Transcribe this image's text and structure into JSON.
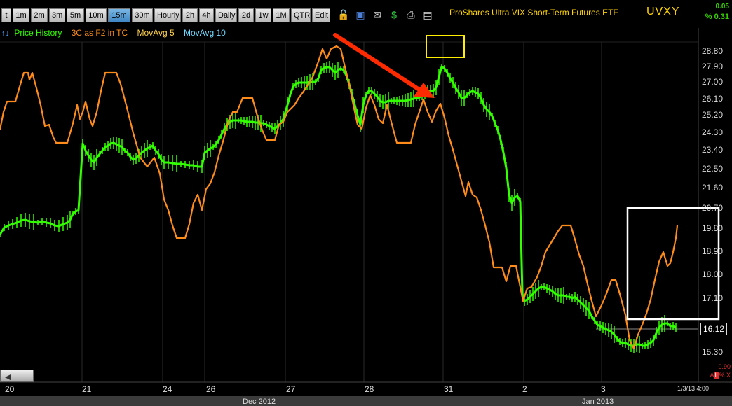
{
  "toolbar": {
    "timeframes": [
      {
        "label": "t"
      },
      {
        "label": "1m"
      },
      {
        "label": "2m"
      },
      {
        "label": "3m"
      },
      {
        "label": "5m"
      },
      {
        "label": "10m"
      },
      {
        "label": "15m",
        "active": true
      },
      {
        "label": "30m"
      },
      {
        "label": "Hourly"
      },
      {
        "label": "2h"
      },
      {
        "label": "4h"
      },
      {
        "label": "Daily"
      },
      {
        "label": "2d"
      },
      {
        "label": "1w"
      },
      {
        "label": "1M"
      },
      {
        "label": "QTR"
      },
      {
        "label": "Edit"
      }
    ],
    "icons": [
      "lock-icon",
      "save-icon",
      "email-icon",
      "dollar-icon",
      "print-icon",
      "card-icon"
    ],
    "symbol_name": "ProShares Ultra VIX Short-Term Futures ETF",
    "ticker": "UVXY",
    "change": "0.05",
    "change_pct": "% 0.31"
  },
  "legend": {
    "arrows": "↑↓",
    "price_history": "Price History",
    "indicator": "3C as F2 in TC",
    "ma5": "MovAvg 5",
    "ma10": "MovAvg 10"
  },
  "colors": {
    "price_candles": "#33ff00",
    "indicator_line": "#ff8c1a",
    "ma5": "#ffd24d",
    "ma10": "#6fd9ff",
    "annotation_arrow": "#ff2a00",
    "highlight_box_top": "#ffee00",
    "highlight_box_right": "#ffffff"
  },
  "price_axis": [
    "28.80",
    "27.90",
    "27.00",
    "26.10",
    "25.20",
    "24.30",
    "23.40",
    "22.50",
    "21.60",
    "20.70",
    "19.80",
    "18.90",
    "18.00",
    "17.10",
    "15.30"
  ],
  "last_price": "16.12",
  "right_red_top": "0.90",
  "right_red_bot": "A",
  "right_red_bot_box": "L",
  "right_red_bot_end": "% X",
  "dates": [
    "20",
    "21",
    "24",
    "26",
    "27",
    "28",
    "31",
    "2",
    "3"
  ],
  "timestamp": "1/3/13 4:00",
  "months": [
    "Dec 2012",
    "Jan 2013"
  ]
}
